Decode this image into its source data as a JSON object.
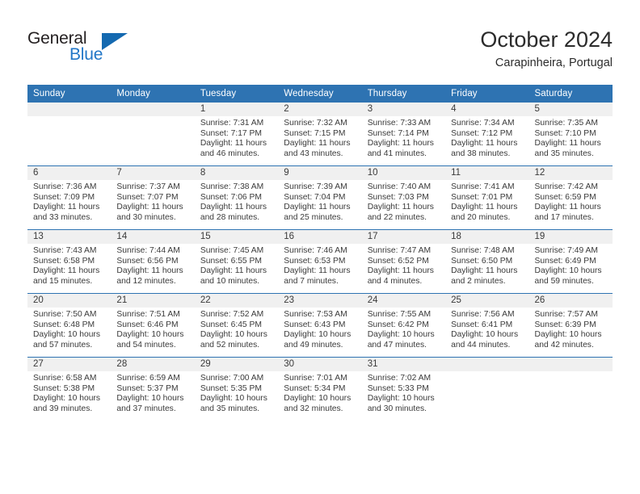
{
  "brand": {
    "name_part1": "General",
    "name_part2": "Blue",
    "triangle_icon": "triangle-icon"
  },
  "header": {
    "month_title": "October 2024",
    "location": "Carapinheira, Portugal"
  },
  "theme": {
    "header_blue": "#2e73b2",
    "daynum_band": "#f0f0f0",
    "text": "#3a3a3a",
    "logo_blue": "#2176c7"
  },
  "calendar": {
    "weekday_headers": [
      "Sunday",
      "Monday",
      "Tuesday",
      "Wednesday",
      "Thursday",
      "Friday",
      "Saturday"
    ],
    "labels": {
      "sunrise": "Sunrise:",
      "sunset": "Sunset:",
      "daylight": "Daylight:"
    },
    "weeks": [
      [
        {
          "day": "",
          "empty": true
        },
        {
          "day": "",
          "empty": true
        },
        {
          "day": "1",
          "sunrise": "Sunrise: 7:31 AM",
          "sunset": "Sunset: 7:17 PM",
          "daylight_line1": "Daylight: 11 hours",
          "daylight_line2": "and 46 minutes."
        },
        {
          "day": "2",
          "sunrise": "Sunrise: 7:32 AM",
          "sunset": "Sunset: 7:15 PM",
          "daylight_line1": "Daylight: 11 hours",
          "daylight_line2": "and 43 minutes."
        },
        {
          "day": "3",
          "sunrise": "Sunrise: 7:33 AM",
          "sunset": "Sunset: 7:14 PM",
          "daylight_line1": "Daylight: 11 hours",
          "daylight_line2": "and 41 minutes."
        },
        {
          "day": "4",
          "sunrise": "Sunrise: 7:34 AM",
          "sunset": "Sunset: 7:12 PM",
          "daylight_line1": "Daylight: 11 hours",
          "daylight_line2": "and 38 minutes."
        },
        {
          "day": "5",
          "sunrise": "Sunrise: 7:35 AM",
          "sunset": "Sunset: 7:10 PM",
          "daylight_line1": "Daylight: 11 hours",
          "daylight_line2": "and 35 minutes."
        }
      ],
      [
        {
          "day": "6",
          "sunrise": "Sunrise: 7:36 AM",
          "sunset": "Sunset: 7:09 PM",
          "daylight_line1": "Daylight: 11 hours",
          "daylight_line2": "and 33 minutes."
        },
        {
          "day": "7",
          "sunrise": "Sunrise: 7:37 AM",
          "sunset": "Sunset: 7:07 PM",
          "daylight_line1": "Daylight: 11 hours",
          "daylight_line2": "and 30 minutes."
        },
        {
          "day": "8",
          "sunrise": "Sunrise: 7:38 AM",
          "sunset": "Sunset: 7:06 PM",
          "daylight_line1": "Daylight: 11 hours",
          "daylight_line2": "and 28 minutes."
        },
        {
          "day": "9",
          "sunrise": "Sunrise: 7:39 AM",
          "sunset": "Sunset: 7:04 PM",
          "daylight_line1": "Daylight: 11 hours",
          "daylight_line2": "and 25 minutes."
        },
        {
          "day": "10",
          "sunrise": "Sunrise: 7:40 AM",
          "sunset": "Sunset: 7:03 PM",
          "daylight_line1": "Daylight: 11 hours",
          "daylight_line2": "and 22 minutes."
        },
        {
          "day": "11",
          "sunrise": "Sunrise: 7:41 AM",
          "sunset": "Sunset: 7:01 PM",
          "daylight_line1": "Daylight: 11 hours",
          "daylight_line2": "and 20 minutes."
        },
        {
          "day": "12",
          "sunrise": "Sunrise: 7:42 AM",
          "sunset": "Sunset: 6:59 PM",
          "daylight_line1": "Daylight: 11 hours",
          "daylight_line2": "and 17 minutes."
        }
      ],
      [
        {
          "day": "13",
          "sunrise": "Sunrise: 7:43 AM",
          "sunset": "Sunset: 6:58 PM",
          "daylight_line1": "Daylight: 11 hours",
          "daylight_line2": "and 15 minutes."
        },
        {
          "day": "14",
          "sunrise": "Sunrise: 7:44 AM",
          "sunset": "Sunset: 6:56 PM",
          "daylight_line1": "Daylight: 11 hours",
          "daylight_line2": "and 12 minutes."
        },
        {
          "day": "15",
          "sunrise": "Sunrise: 7:45 AM",
          "sunset": "Sunset: 6:55 PM",
          "daylight_line1": "Daylight: 11 hours",
          "daylight_line2": "and 10 minutes."
        },
        {
          "day": "16",
          "sunrise": "Sunrise: 7:46 AM",
          "sunset": "Sunset: 6:53 PM",
          "daylight_line1": "Daylight: 11 hours",
          "daylight_line2": "and 7 minutes."
        },
        {
          "day": "17",
          "sunrise": "Sunrise: 7:47 AM",
          "sunset": "Sunset: 6:52 PM",
          "daylight_line1": "Daylight: 11 hours",
          "daylight_line2": "and 4 minutes."
        },
        {
          "day": "18",
          "sunrise": "Sunrise: 7:48 AM",
          "sunset": "Sunset: 6:50 PM",
          "daylight_line1": "Daylight: 11 hours",
          "daylight_line2": "and 2 minutes."
        },
        {
          "day": "19",
          "sunrise": "Sunrise: 7:49 AM",
          "sunset": "Sunset: 6:49 PM",
          "daylight_line1": "Daylight: 10 hours",
          "daylight_line2": "and 59 minutes."
        }
      ],
      [
        {
          "day": "20",
          "sunrise": "Sunrise: 7:50 AM",
          "sunset": "Sunset: 6:48 PM",
          "daylight_line1": "Daylight: 10 hours",
          "daylight_line2": "and 57 minutes."
        },
        {
          "day": "21",
          "sunrise": "Sunrise: 7:51 AM",
          "sunset": "Sunset: 6:46 PM",
          "daylight_line1": "Daylight: 10 hours",
          "daylight_line2": "and 54 minutes."
        },
        {
          "day": "22",
          "sunrise": "Sunrise: 7:52 AM",
          "sunset": "Sunset: 6:45 PM",
          "daylight_line1": "Daylight: 10 hours",
          "daylight_line2": "and 52 minutes."
        },
        {
          "day": "23",
          "sunrise": "Sunrise: 7:53 AM",
          "sunset": "Sunset: 6:43 PM",
          "daylight_line1": "Daylight: 10 hours",
          "daylight_line2": "and 49 minutes."
        },
        {
          "day": "24",
          "sunrise": "Sunrise: 7:55 AM",
          "sunset": "Sunset: 6:42 PM",
          "daylight_line1": "Daylight: 10 hours",
          "daylight_line2": "and 47 minutes."
        },
        {
          "day": "25",
          "sunrise": "Sunrise: 7:56 AM",
          "sunset": "Sunset: 6:41 PM",
          "daylight_line1": "Daylight: 10 hours",
          "daylight_line2": "and 44 minutes."
        },
        {
          "day": "26",
          "sunrise": "Sunrise: 7:57 AM",
          "sunset": "Sunset: 6:39 PM",
          "daylight_line1": "Daylight: 10 hours",
          "daylight_line2": "and 42 minutes."
        }
      ],
      [
        {
          "day": "27",
          "sunrise": "Sunrise: 6:58 AM",
          "sunset": "Sunset: 5:38 PM",
          "daylight_line1": "Daylight: 10 hours",
          "daylight_line2": "and 39 minutes."
        },
        {
          "day": "28",
          "sunrise": "Sunrise: 6:59 AM",
          "sunset": "Sunset: 5:37 PM",
          "daylight_line1": "Daylight: 10 hours",
          "daylight_line2": "and 37 minutes."
        },
        {
          "day": "29",
          "sunrise": "Sunrise: 7:00 AM",
          "sunset": "Sunset: 5:35 PM",
          "daylight_line1": "Daylight: 10 hours",
          "daylight_line2": "and 35 minutes."
        },
        {
          "day": "30",
          "sunrise": "Sunrise: 7:01 AM",
          "sunset": "Sunset: 5:34 PM",
          "daylight_line1": "Daylight: 10 hours",
          "daylight_line2": "and 32 minutes."
        },
        {
          "day": "31",
          "sunrise": "Sunrise: 7:02 AM",
          "sunset": "Sunset: 5:33 PM",
          "daylight_line1": "Daylight: 10 hours",
          "daylight_line2": "and 30 minutes."
        },
        {
          "day": "",
          "empty": true
        },
        {
          "day": "",
          "empty": true
        }
      ]
    ]
  }
}
